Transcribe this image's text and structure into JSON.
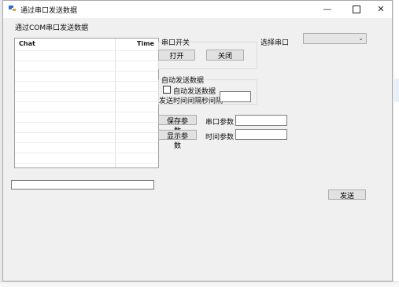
{
  "window": {
    "title": "通过串口发送数据",
    "controls": {
      "minimize": "—",
      "close": "✕"
    }
  },
  "left_group": {
    "label": "通过COM串口发送数据",
    "chat_header": {
      "chat": "Chat",
      "time": "Time"
    },
    "message_value": ""
  },
  "port_switch": {
    "label": "串口开关",
    "open_button": "打开",
    "close_button": "关闭"
  },
  "select_port": {
    "label": "选择串口",
    "selected": ""
  },
  "auto_send": {
    "label": "自动发送数据",
    "checkbox_label": "自动发送数据",
    "checked": false,
    "interval_label": "发送时间间隔秒间隔",
    "interval_value": ""
  },
  "params": {
    "save_button": "保存参数",
    "show_button": "显示参数",
    "port_param_label": "串口参数",
    "port_param_value": "",
    "time_param_label": "时间参数",
    "time_param_value": ""
  },
  "send_button": "发送"
}
